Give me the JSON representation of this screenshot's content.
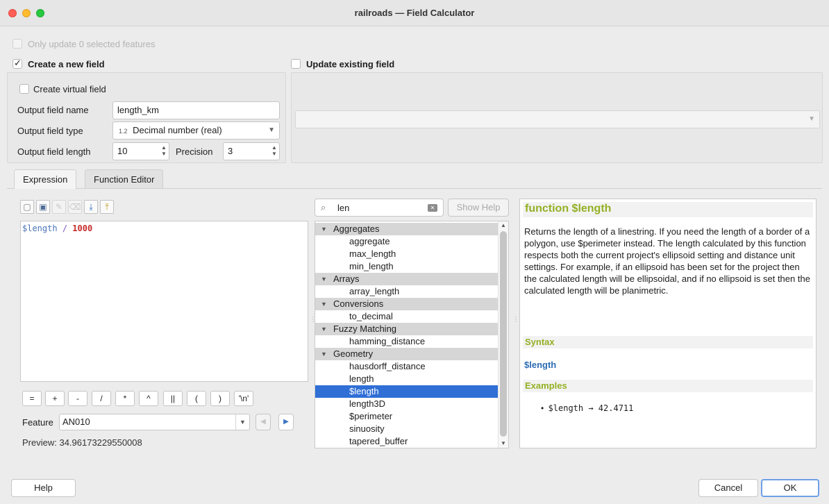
{
  "window": {
    "title": "railroads — Field Calculator"
  },
  "top": {
    "only_update_label": "Only update 0 selected features",
    "create_new_field_label": "Create a new field",
    "update_existing_label": "Update existing field"
  },
  "new_field": {
    "virtual_label": "Create virtual field",
    "name_label": "Output field name",
    "name_value": "length_km",
    "type_label": "Output field type",
    "type_prefix": "1.2",
    "type_value": "Decimal number (real)",
    "length_label": "Output field length",
    "length_value": "10",
    "precision_label": "Precision",
    "precision_value": "3"
  },
  "tabs": {
    "expression": "Expression",
    "function_editor": "Function Editor"
  },
  "editor": {
    "var": "$length",
    "op": "/",
    "num": "1000"
  },
  "operators": [
    "=",
    "+",
    "-",
    "/",
    "*",
    "^",
    "||",
    "(",
    ")",
    "'\\n'"
  ],
  "feature": {
    "label": "Feature",
    "value": "AN010"
  },
  "preview": {
    "text": "Preview:  34.96173229550008"
  },
  "search": {
    "value": "len",
    "show_help": "Show Help"
  },
  "tree": {
    "rows": [
      {
        "label": "Aggregates",
        "group": true
      },
      {
        "label": "aggregate"
      },
      {
        "label": "max_length"
      },
      {
        "label": "min_length"
      },
      {
        "label": "Arrays",
        "group": true
      },
      {
        "label": "array_length"
      },
      {
        "label": "Conversions",
        "group": true
      },
      {
        "label": "to_decimal"
      },
      {
        "label": "Fuzzy Matching",
        "group": true
      },
      {
        "label": "hamming_distance"
      },
      {
        "label": "Geometry",
        "group": true
      },
      {
        "label": "hausdorff_distance"
      },
      {
        "label": "length"
      },
      {
        "label": "$length",
        "selected": true
      },
      {
        "label": "length3D"
      },
      {
        "label": "$perimeter"
      },
      {
        "label": "sinuosity"
      },
      {
        "label": "tapered_buffer"
      }
    ]
  },
  "help": {
    "title": "function $length",
    "description": "Returns the length of a linestring. If you need the length of a border of a polygon, use $perimeter instead. The length calculated by this function respects both the current project's ellipsoid setting and distance unit settings. For example, if an ellipsoid has been set for the project then the calculated length will be ellipsoidal, and if no ellipsoid is set then the calculated length will be planimetric.",
    "syntax_header": "Syntax",
    "syntax": "$length",
    "examples_header": "Examples",
    "example": "$length → 42.4711"
  },
  "buttons": {
    "help": "Help",
    "cancel": "Cancel",
    "ok": "OK"
  },
  "colors": {
    "accent": "#2f6fd6",
    "help_heading": "#93b023",
    "syntax_blue": "#2d6db4",
    "number_red": "#c62a2a"
  }
}
